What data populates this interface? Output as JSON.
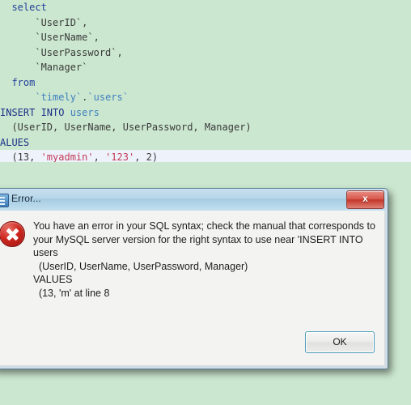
{
  "background_color": "#cbe7cf",
  "editor": {
    "name": "sql-editor",
    "lines": [
      {
        "id": "l1",
        "current": false,
        "segments": [
          {
            "text": "  select",
            "cls": "kw"
          }
        ]
      },
      {
        "id": "l2",
        "current": false,
        "segments": [
          {
            "text": "      `UserID`,",
            "cls": "plain"
          }
        ]
      },
      {
        "id": "l3",
        "current": false,
        "segments": [
          {
            "text": "      `UserName`,",
            "cls": "plain"
          }
        ]
      },
      {
        "id": "l4",
        "current": false,
        "segments": [
          {
            "text": "      `UserPassword`,",
            "cls": "plain"
          }
        ]
      },
      {
        "id": "l5",
        "current": false,
        "segments": [
          {
            "text": "      `Manager`",
            "cls": "plain"
          }
        ]
      },
      {
        "id": "l6",
        "current": false,
        "segments": [
          {
            "text": "  from",
            "cls": "kw"
          }
        ]
      },
      {
        "id": "l7",
        "current": false,
        "segments": [
          {
            "text": "      `timely`",
            "cls": "ident"
          },
          {
            "text": ".",
            "cls": "plain"
          },
          {
            "text": "`users`",
            "cls": "ident"
          }
        ]
      },
      {
        "id": "l8",
        "current": false,
        "segments": [
          {
            "text": "INSERT INTO ",
            "cls": "kw-cap"
          },
          {
            "text": "users",
            "cls": "ident"
          }
        ]
      },
      {
        "id": "l9",
        "current": false,
        "segments": [
          {
            "text": "  (UserID, UserName, UserPassword, Manager)",
            "cls": "plain"
          }
        ]
      },
      {
        "id": "l10",
        "current": false,
        "segments": [
          {
            "text": "ALUES",
            "cls": "kw-cap"
          }
        ]
      },
      {
        "id": "l11",
        "current": true,
        "segments": [
          {
            "text": "  (13, ",
            "cls": "plain"
          },
          {
            "text": "'myadmin'",
            "cls": "str"
          },
          {
            "text": ", ",
            "cls": "plain"
          },
          {
            "text": "'123'",
            "cls": "str"
          },
          {
            "text": ", 2)",
            "cls": "plain"
          }
        ]
      }
    ]
  },
  "dialog": {
    "title": "Error...",
    "title_icon": "window-icon",
    "close_label": "x",
    "error_icon": "error-circle-x-icon",
    "message_lines": [
      "You have an error in your SQL syntax; check the manual that corresponds to",
      "your MySQL server version for the right syntax to use near 'INSERT INTO",
      "users",
      "  (UserID, UserName, UserPassword, Manager)",
      "VALUES",
      "  (13, 'm' at line 8"
    ],
    "ok_label": "OK",
    "colors": {
      "titlebar": "#b6d6e9",
      "body": "#f3f3f2",
      "close_button": "#c23427",
      "ok_focus_border": "#4f9dbb",
      "error_red": "#cf2720"
    }
  }
}
